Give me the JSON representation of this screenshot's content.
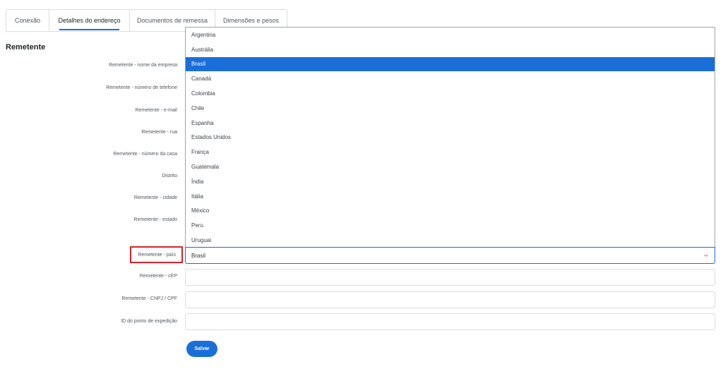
{
  "tabs": [
    {
      "label": "Conexão"
    },
    {
      "label": "Detalhes do endereço"
    },
    {
      "label": "Documentos de remessa"
    },
    {
      "label": "Dimensões e pesos"
    }
  ],
  "section_title": "Remetente",
  "fields": {
    "company_name": "Remetente - nome da empresa",
    "phone": "Remetente - número de telefone",
    "email": "Remetente - e-mail",
    "street": "Remetente - rua",
    "house_number": "Remetente - número da casa",
    "district": "Distrito",
    "city": "Remetente - cidade",
    "state": "Remetente - estado",
    "country": "Remetente - país",
    "zip": "Remetente - cEP",
    "tax_id": "Remetente - CNPJ / CPF",
    "dispatch_point": "ID do ponto de expedição"
  },
  "country_select": {
    "value": "Brasil",
    "options": [
      "Argentina",
      "Austrália",
      "Brasil",
      "Canadá",
      "Colombia",
      "Chile",
      "Espanha",
      "Estados Unidos",
      "França",
      "Guatemala",
      "Índia",
      "Itália",
      "México",
      "Peru",
      "Uruguai"
    ],
    "selected": "Brasil"
  },
  "save_label": "Salvar",
  "colors": {
    "accent": "#1a6ed8",
    "highlight": "#d6242b"
  }
}
